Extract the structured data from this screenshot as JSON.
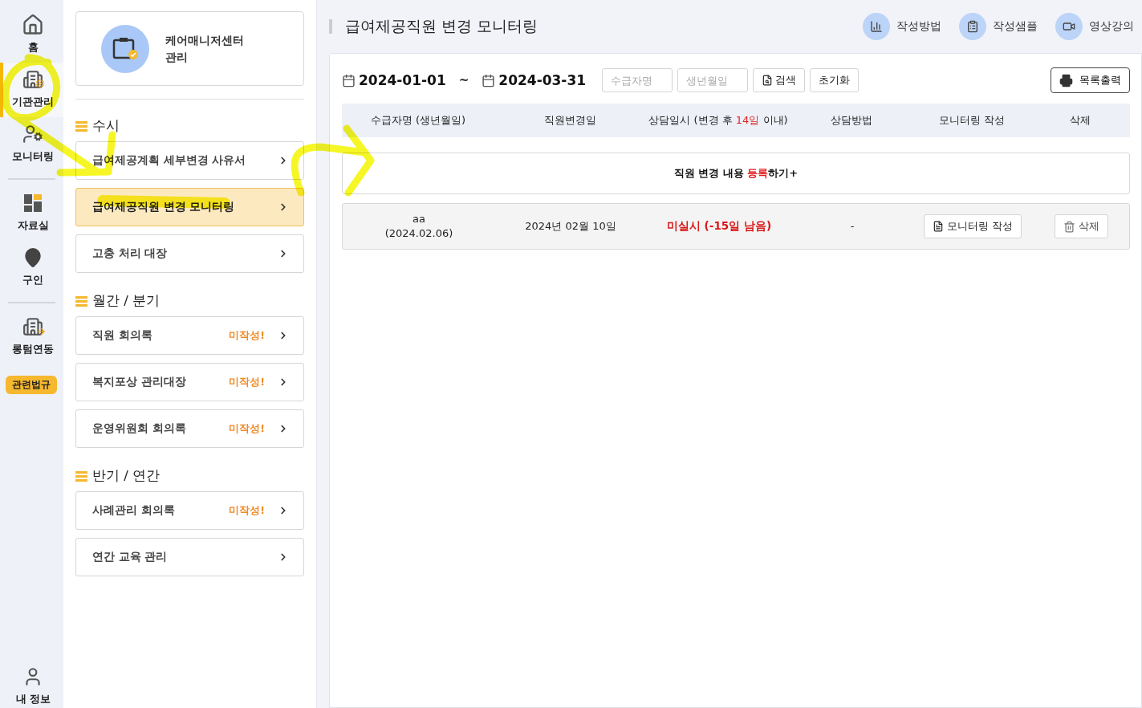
{
  "rail": {
    "items": [
      {
        "label": "홈",
        "kind": "home",
        "selected": false
      },
      {
        "label": "기관관리",
        "kind": "building-gear",
        "selected": true
      },
      {
        "label": "모니터링",
        "kind": "user-gear",
        "selected": false
      },
      {
        "label": "자료실",
        "kind": "grid",
        "selected": false
      },
      {
        "label": "구인",
        "kind": "pin",
        "selected": false
      },
      {
        "label": "롱텀연동",
        "kind": "building-arrow",
        "selected": false
      }
    ],
    "badge": "관련법규",
    "account": "내 정보"
  },
  "center_card": {
    "title": "케어매니저센터\n관리"
  },
  "menu_groups": [
    {
      "title": "수시",
      "items": [
        {
          "label": "급여제공계획 세부변경 사유서",
          "selected": false
        },
        {
          "label": "급여제공직원 변경 모니터링",
          "selected": true
        },
        {
          "label": "고충 처리 대장",
          "selected": false
        }
      ]
    },
    {
      "title": "월간 / 분기",
      "items": [
        {
          "label": "직원 회의록",
          "selected": false,
          "status": "미작성!"
        },
        {
          "label": "복지포상 관리대장",
          "selected": false,
          "status": "미작성!"
        },
        {
          "label": "운영위원회 회의록",
          "selected": false,
          "status": "미작성!"
        }
      ]
    },
    {
      "title": "반기 / 연간",
      "items": [
        {
          "label": "사례관리 회의록",
          "selected": false,
          "status": "미작성!"
        },
        {
          "label": "연간 교육 관리",
          "selected": false
        }
      ]
    }
  ],
  "page_title": "급여제공직원 변경 모니터링",
  "help_links": [
    {
      "label": "작성방법",
      "kind": "chart"
    },
    {
      "label": "작성샘플",
      "kind": "doc"
    },
    {
      "label": "영상강의",
      "kind": "video"
    }
  ],
  "filters": {
    "date_from": "2024-01-01",
    "separator": "~",
    "date_to": "2024-03-31",
    "name_placeholder": "수급자명",
    "birth_placeholder": "생년월일",
    "search": "검색",
    "reset": "초기화",
    "print": "목록출력"
  },
  "table": {
    "columns": [
      {
        "parts": [
          {
            "text": "수급자명 (생년월일)",
            "highlight": false
          }
        ]
      },
      {
        "parts": [
          {
            "text": "직원변경일",
            "highlight": false
          }
        ]
      },
      {
        "parts": [
          {
            "text": "상담일시 (변경 후 ",
            "highlight": false
          },
          {
            "text": "14일",
            "highlight": true
          },
          {
            "text": " 이내)",
            "highlight": false
          }
        ]
      },
      {
        "parts": [
          {
            "text": "상담방법",
            "highlight": false
          }
        ]
      },
      {
        "parts": [
          {
            "text": "모니터링 작성",
            "highlight": false
          }
        ]
      },
      {
        "parts": [
          {
            "text": "삭제",
            "highlight": false
          }
        ]
      }
    ],
    "register": [
      {
        "text": "직원 변경 내용 ",
        "highlight": false
      },
      {
        "text": "등록",
        "highlight": true
      },
      {
        "text": "하기+",
        "highlight": false
      }
    ],
    "rows": [
      {
        "name": "aa",
        "birth": "(2024.02.06)",
        "change_date": "2024년 02월 10일",
        "consult": "미실시 (-15일 남음)",
        "method": "-",
        "write": "모니터링 작성",
        "delete": "삭제"
      }
    ]
  }
}
